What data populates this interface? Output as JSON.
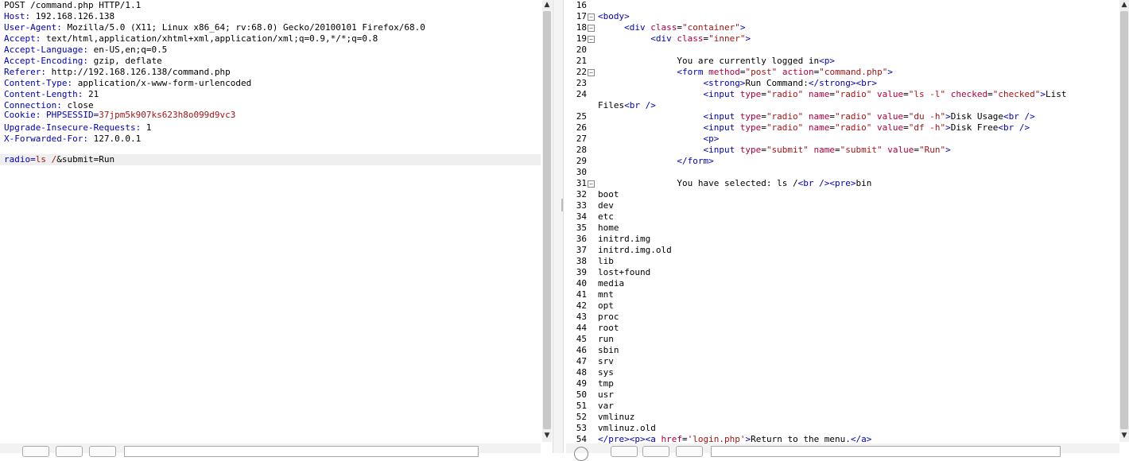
{
  "request": {
    "request_line": "POST /command.php HTTP/1.1",
    "headers": [
      {
        "name": "Host",
        "value": "192.168.126.138"
      },
      {
        "name": "User-Agent",
        "value": "Mozilla/5.0 (X11; Linux x86_64; rv:68.0) Gecko/20100101 Firefox/68.0"
      },
      {
        "name": "Accept",
        "value": "text/html,application/xhtml+xml,application/xml;q=0.9,*/*;q=0.8"
      },
      {
        "name": "Accept-Language",
        "value": "en-US,en;q=0.5"
      },
      {
        "name": "Accept-Encoding",
        "value": "gzip, deflate"
      },
      {
        "name": "Referer",
        "value": "http://192.168.126.138/command.php"
      },
      {
        "name": "Content-Type",
        "value": "application/x-www-form-urlencoded"
      },
      {
        "name": "Content-Length",
        "value": "21"
      },
      {
        "name": "Connection",
        "value": "close"
      },
      {
        "name": "Upgrade-Insecure-Requests",
        "value": "1"
      },
      {
        "name": "X-Forwarded-For",
        "value": "127.0.0.1"
      }
    ],
    "cookie": {
      "label": "Cookie",
      "name": "PHPSESSID",
      "value": "37jpm5k907ks623h8o099d9vc3"
    },
    "body": {
      "param1": "radio",
      "value1": "ls /",
      "rest": "&submit=Run"
    }
  },
  "response": {
    "line_numbers": [
      "16",
      "17",
      "18",
      "19",
      "20",
      "21",
      "22",
      "23",
      "24",
      "",
      "25",
      "26",
      "27",
      "28",
      "29",
      "30",
      "31",
      "32",
      "33",
      "34",
      "35",
      "36",
      "37",
      "38",
      "39",
      "40",
      "41",
      "42",
      "43",
      "44",
      "45",
      "46",
      "47",
      "48",
      "49",
      "50",
      "51",
      "52",
      "53",
      "54"
    ],
    "listing": [
      "boot",
      "dev",
      "etc",
      "home",
      "initrd.img",
      "initrd.img.old",
      "lib",
      "lost+found",
      "media",
      "mnt",
      "opt",
      "proc",
      "root",
      "run",
      "sbin",
      "srv",
      "sys",
      "tmp",
      "usr",
      "var",
      "vmlinuz",
      "vmlinuz.old"
    ],
    "logged_in_text": "You are currently logged in",
    "selected_text": "You have selected: ls /",
    "first_listing": "bin",
    "run_command": "Run Command:",
    "list_files": "List",
    "list_files_cont": "Files",
    "disk_usage": "Disk Usage",
    "disk_free": "Disk Free",
    "return_text": "Return to the menu."
  }
}
